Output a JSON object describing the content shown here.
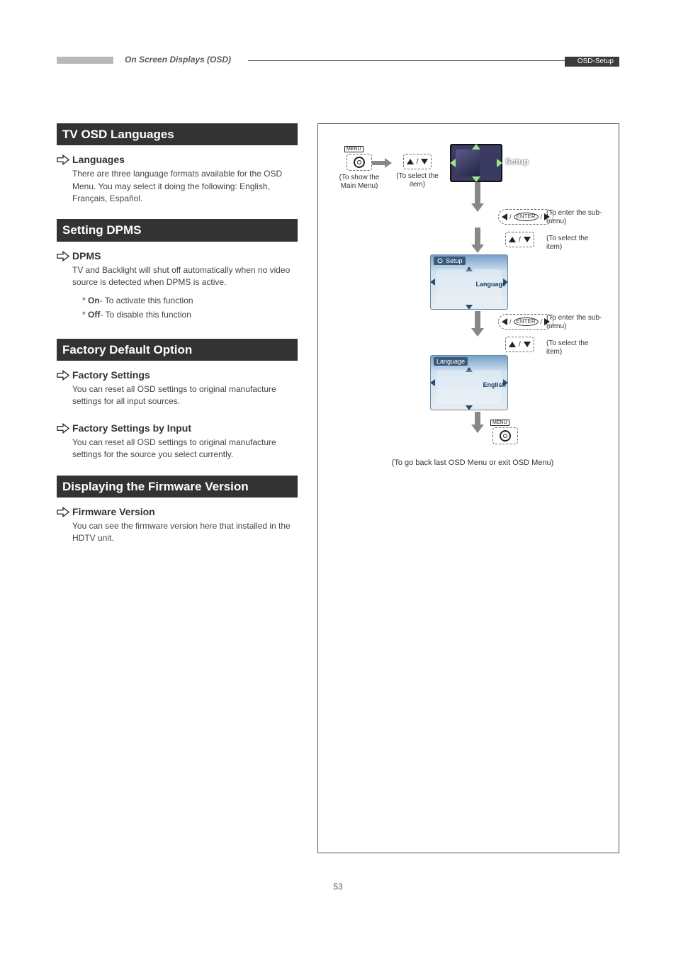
{
  "header": {
    "left_label": "On Screen Displays (OSD)",
    "right_tab": "OSD-Setup"
  },
  "sections": {
    "tv_osd_languages": {
      "title": "TV OSD Languages",
      "sub": "Languages",
      "body": "There are three language formats available for the OSD Menu. You may select it doing the following: English, Français, Español."
    },
    "setting_dpms": {
      "title": "Setting DPMS",
      "sub": "DPMS",
      "body": "TV and Backlight will shut off automatically when no video source is detected when DPMS is active.",
      "bullets": [
        {
          "prefix": "* ",
          "strong": "On",
          "rest": "- To activate this function"
        },
        {
          "prefix": "* ",
          "strong": "Off",
          "rest": "- To disable this function"
        }
      ]
    },
    "factory_default": {
      "title": "Factory Default Option",
      "sub1": "Factory Settings",
      "body1": "You can reset all OSD settings to original manufacture settings for all input sources.",
      "sub2": "Factory Settings by Input",
      "body2": "You can reset all OSD settings to original manufacture settings for the source you select currently."
    },
    "firmware": {
      "title": "Displaying the Firmware Version",
      "sub": "Firmware Version",
      "body": "You can see the firmware version here that installed in the HDTV unit."
    }
  },
  "flow": {
    "menu_key_label": "MENU",
    "show_main_caption": "(To show the Main Menu)",
    "select_item_caption": "(To select the item)",
    "setup_label": "Setup",
    "enter_sub_caption": "(To enter the sub-menu)",
    "select_item_caption_2": "(To select the item)",
    "setup_tab": "Setup",
    "language_label": "Language",
    "enter_sub_caption_2": "(To enter the sub-menu)",
    "select_item_caption_3": "(To select the item)",
    "language_tab": "Language",
    "english_label": "English",
    "go_back_caption": "(To go back last OSD Menu or exit OSD Menu)"
  },
  "page_number": "53"
}
